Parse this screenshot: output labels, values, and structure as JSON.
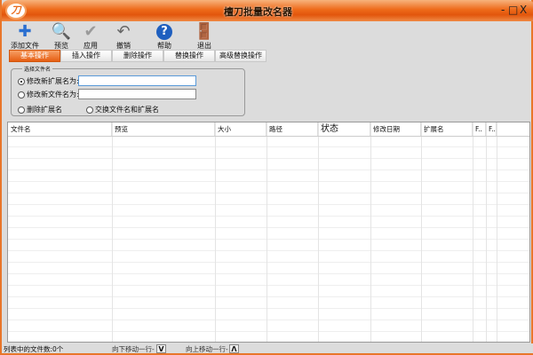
{
  "title": "檀刀批量改名器",
  "window_controls": {
    "minimize": "-",
    "maximize": "□",
    "close": "X"
  },
  "logo_text": "刀",
  "toolbar": [
    {
      "label": "添加文件",
      "icon": "plus-icon",
      "glyph": "✚",
      "color": "#2a6fd0"
    },
    {
      "label": "预览",
      "icon": "preview-icon",
      "glyph": "🔍",
      "color": "#6a8ab0"
    },
    {
      "label": "应用",
      "icon": "check-icon",
      "glyph": "✔",
      "color": "#9a9a9a"
    },
    {
      "label": "撤销",
      "icon": "undo-icon",
      "glyph": "↶",
      "color": "#666"
    },
    {
      "label": "帮助",
      "icon": "help-icon",
      "glyph": "?",
      "color": "#1f5fbf"
    },
    {
      "label": "退出",
      "icon": "exit-icon",
      "glyph": "🚪",
      "color": "#b0602a"
    }
  ],
  "tabs": [
    "基本操作",
    "插入操作",
    "删除操作",
    "替换操作",
    "高级替换操作"
  ],
  "group": {
    "title": "选择文件名",
    "options": [
      "修改新扩展名为:",
      "修改新文件名为:",
      "删除扩展名",
      "交换文件名和扩展名"
    ],
    "ext_value": "",
    "name_value": ""
  },
  "columns": [
    "文件名",
    "预览",
    "大小",
    "路径",
    "状态",
    "修改日期",
    "扩展名",
    "F..",
    "F.."
  ],
  "status": {
    "count": "列表中的文件数:0个",
    "down_label": "向下移动一行-",
    "down_btn": "V",
    "up_label": "向上移动一行-",
    "up_btn": "Λ"
  }
}
